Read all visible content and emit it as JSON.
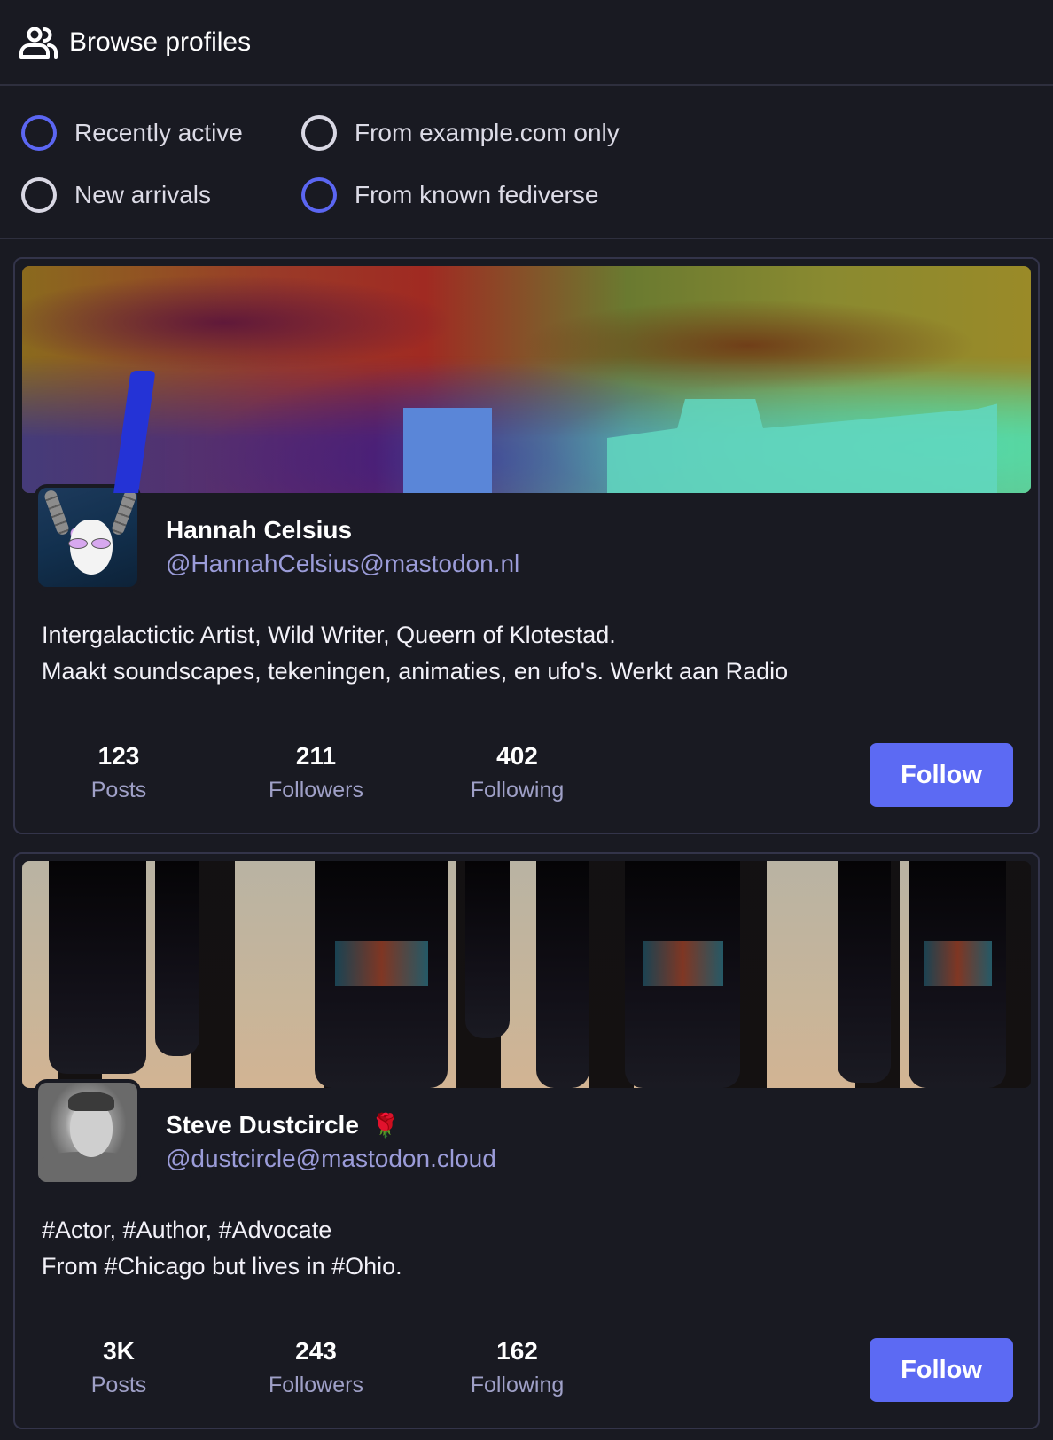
{
  "header": {
    "icon": "users-icon",
    "title": "Browse profiles"
  },
  "filters": [
    {
      "label": "Recently active",
      "selected": true
    },
    {
      "label": "From example.com only",
      "selected": false
    },
    {
      "label": "New arrivals",
      "selected": false
    },
    {
      "label": "From known fediverse",
      "selected": true
    }
  ],
  "accent_color": "#5c6af3",
  "profiles": [
    {
      "display_name": "Hannah Celsius",
      "emoji": "",
      "handle": "@HannahCelsius@mastodon.nl",
      "bio": [
        "Intergalactictic Artist, Wild Writer, Queern of Klotestad.",
        "Maakt soundscapes, tekeningen, animaties, en ufo's. Werkt aan Radio"
      ],
      "stats": [
        {
          "value": "123",
          "label": "Posts"
        },
        {
          "value": "211",
          "label": "Followers"
        },
        {
          "value": "402",
          "label": "Following"
        }
      ],
      "follow_label": "Follow"
    },
    {
      "display_name": "Steve Dustcircle",
      "emoji": "🌹",
      "handle": "@dustcircle@mastodon.cloud",
      "bio": [
        "#Actor, #Author, #Advocate",
        "From #Chicago but lives in #Ohio."
      ],
      "stats": [
        {
          "value": "3K",
          "label": "Posts"
        },
        {
          "value": "243",
          "label": "Followers"
        },
        {
          "value": "162",
          "label": "Following"
        }
      ],
      "follow_label": "Follow"
    }
  ]
}
